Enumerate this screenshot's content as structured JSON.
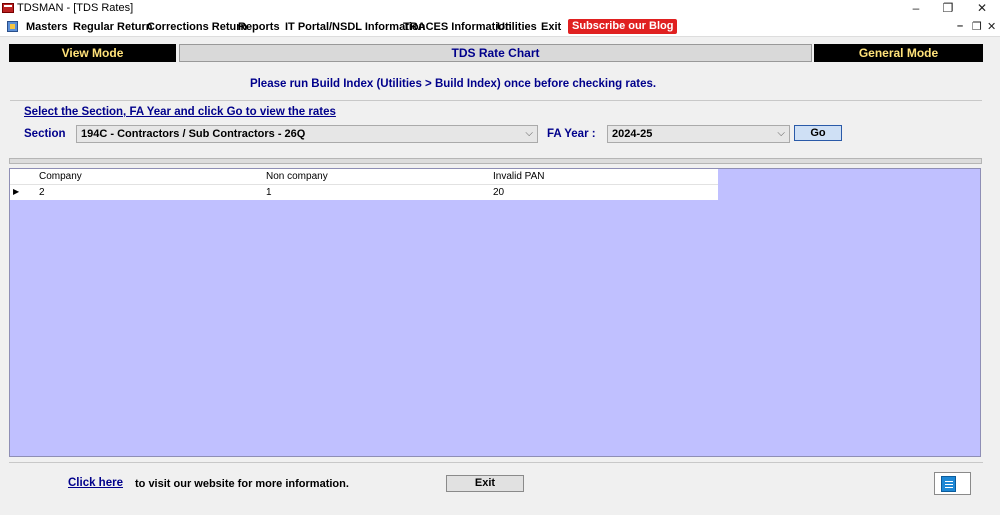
{
  "window": {
    "title": "TDSMAN - [TDS Rates]",
    "controls": {
      "minimize": "–",
      "restore": "❐",
      "close": "✕"
    },
    "mdi_controls": {
      "minimize": "–",
      "restore": "❐",
      "close": "✕"
    }
  },
  "menu": {
    "items": [
      "Masters",
      "Regular Return",
      "Corrections Return",
      "Reports",
      "IT Portal/NSDL Information",
      "TRACES Information",
      "Utilities",
      "Exit"
    ],
    "subscribe": "Subscribe our Blog"
  },
  "modebar": {
    "left": "View Mode",
    "center": "TDS Rate Chart",
    "right": "General Mode"
  },
  "notice": "Please run Build Index (Utilities > Build Index) once before checking rates.",
  "selection": {
    "instruction": "Select the Section, FA Year and click Go to view the rates",
    "section_label": "Section",
    "section_value": "194C - Contractors / Sub Contractors - 26Q",
    "fa_year_label": "FA Year :",
    "fa_year_value": "2024-25",
    "go_label": "Go"
  },
  "grid": {
    "columns": [
      "Company",
      "Non company",
      "Invalid PAN"
    ],
    "rows": [
      [
        "2",
        "1",
        "20"
      ]
    ]
  },
  "footer": {
    "click_here": "Click here",
    "visit_text": "to visit our website for more information.",
    "exit_label": "Exit"
  },
  "colors": {
    "accent_text": "#00008b",
    "mode_text": "#ffe27a",
    "grid_background": "#c0c0ff",
    "subscribe_bg": "#e02020"
  }
}
